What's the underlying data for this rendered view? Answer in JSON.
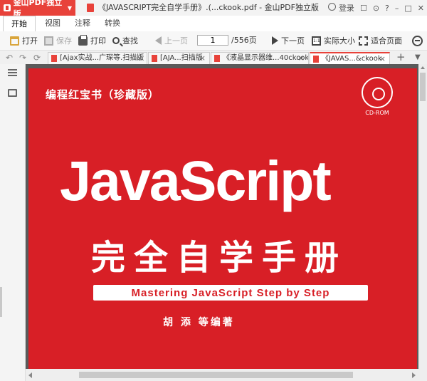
{
  "app": {
    "name": "金山PDF独立版",
    "window_title": "《JAVASCRIPT完全自学手册》.(...ckook.pdf - 金山PDF独立版",
    "login_label": "登录",
    "help_label": "?",
    "brand_color": "#e8423a"
  },
  "menu": {
    "items": [
      {
        "label": "开始",
        "active": true
      },
      {
        "label": "视图",
        "active": false
      },
      {
        "label": "注释",
        "active": false
      },
      {
        "label": "转换",
        "active": false
      }
    ]
  },
  "toolbar": {
    "open": "打开",
    "save": "保存",
    "print": "打印",
    "find": "查找",
    "prev": "上一页",
    "page_current": "1",
    "page_total": "/556页",
    "next": "下一页",
    "actual_size": "实际大小",
    "fit_page": "适合页面"
  },
  "tabs": [
    {
      "label": "[Ajax实战...广琛等.扫描版",
      "active": false
    },
    {
      "label": "[AJA...扫描版",
      "active": false
    },
    {
      "label": "《液晶显示器维...40ckook",
      "active": false
    },
    {
      "label": "《JAVAS...&ckook",
      "active": true
    }
  ],
  "cover": {
    "series": "编程红宝书（珍藏版）",
    "cd_label": "CD-ROM",
    "title_en": "JavaScript",
    "title_cn": "完全自学手册",
    "subtitle": "Mastering JavaScript Step by Step",
    "author": "胡 添  等编著",
    "background": "#d81f26"
  }
}
